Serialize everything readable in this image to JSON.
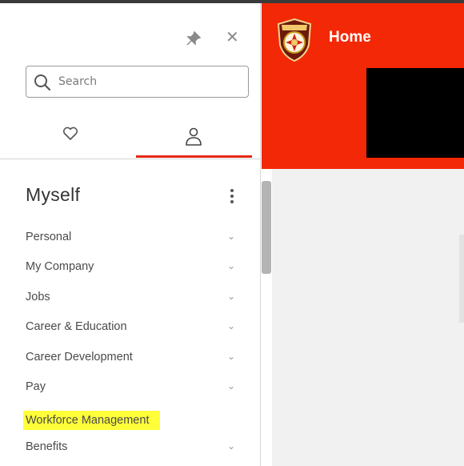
{
  "header": {
    "title": "Home"
  },
  "sidebar": {
    "search": {
      "placeholder": "Search"
    },
    "tabs": [
      {
        "name": "favorites",
        "icon": "heart-icon",
        "active": false
      },
      {
        "name": "myself",
        "icon": "person-icon",
        "active": true
      }
    ],
    "section_title": "Myself",
    "items": [
      {
        "label": "Personal",
        "has_chevron": true
      },
      {
        "label": "My Company",
        "has_chevron": true
      },
      {
        "label": "Jobs",
        "has_chevron": true
      },
      {
        "label": "Career & Education",
        "has_chevron": true
      },
      {
        "label": "Career Development",
        "has_chevron": true
      },
      {
        "label": "Pay",
        "has_chevron": true
      },
      {
        "label": "Workforce Management",
        "has_chevron": false,
        "highlighted": true
      },
      {
        "label": "Benefits",
        "has_chevron": true
      }
    ]
  },
  "colors": {
    "header_red": "#f32807",
    "tab_indicator": "#e4280f",
    "highlight_yellow": "#ffff3a",
    "black_box": "#000000"
  }
}
